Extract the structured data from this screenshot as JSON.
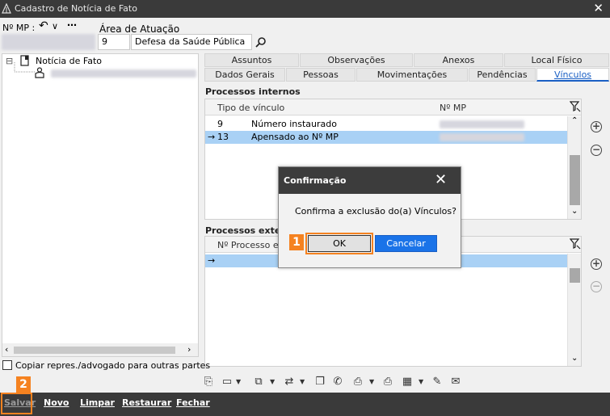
{
  "window": {
    "title": "Cadastro de Notícia de Fato",
    "close_glyph": "✕"
  },
  "form": {
    "mp_label": "Nº MP :",
    "area_label": "Área de Atuação",
    "area_code": "9",
    "area_name": "Defesa da Saúde Pública"
  },
  "tree": {
    "root_label": "Notícia de Fato",
    "expand_glyph": "⊟"
  },
  "tabs_row1": [
    "Assuntos",
    "Observações",
    "Anexos",
    "Local Físico"
  ],
  "tabs_row2": [
    "Dados Gerais",
    "Pessoas",
    "Movimentações",
    "Pendências",
    "Vínculos"
  ],
  "internos": {
    "title": "Processos internos",
    "col1": "Tipo de vínculo",
    "col2": "Nº MP",
    "rows": [
      {
        "code": "9",
        "desc": "Número instaurado"
      },
      {
        "code": "13",
        "desc": "Apensado ao Nº MP"
      }
    ]
  },
  "externos": {
    "title": "Processos externos",
    "col1": "Nº Processo ex"
  },
  "dialog": {
    "title": "Confirmação",
    "message": "Confirma a exclusão do(a) Vínculos?",
    "ok": "OK",
    "cancel": "Cancelar"
  },
  "checkbox_label": "Copiar repres./advogado para outras partes",
  "bottom": {
    "salvar": "Salvar",
    "novo": "Novo",
    "limpar": "Limpar",
    "restaurar": "Restaurar",
    "fechar": "Fechar"
  },
  "badges": {
    "one": "1",
    "two": "2"
  },
  "colors": {
    "accent": "#1a5fc4",
    "badge": "#f58220",
    "selection": "#a9d1f5"
  }
}
